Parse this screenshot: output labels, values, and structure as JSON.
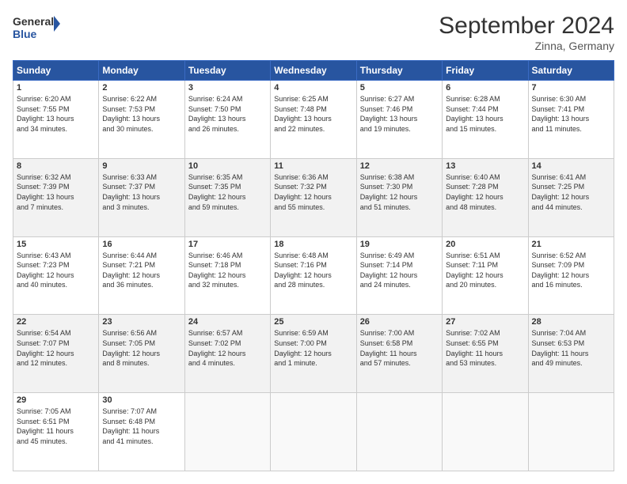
{
  "logo": {
    "line1": "General",
    "line2": "Blue"
  },
  "title": "September 2024",
  "location": "Zinna, Germany",
  "days_header": [
    "Sunday",
    "Monday",
    "Tuesday",
    "Wednesday",
    "Thursday",
    "Friday",
    "Saturday"
  ],
  "weeks": [
    [
      {
        "day": "1",
        "info": "Sunrise: 6:20 AM\nSunset: 7:55 PM\nDaylight: 13 hours\nand 34 minutes."
      },
      {
        "day": "2",
        "info": "Sunrise: 6:22 AM\nSunset: 7:53 PM\nDaylight: 13 hours\nand 30 minutes."
      },
      {
        "day": "3",
        "info": "Sunrise: 6:24 AM\nSunset: 7:50 PM\nDaylight: 13 hours\nand 26 minutes."
      },
      {
        "day": "4",
        "info": "Sunrise: 6:25 AM\nSunset: 7:48 PM\nDaylight: 13 hours\nand 22 minutes."
      },
      {
        "day": "5",
        "info": "Sunrise: 6:27 AM\nSunset: 7:46 PM\nDaylight: 13 hours\nand 19 minutes."
      },
      {
        "day": "6",
        "info": "Sunrise: 6:28 AM\nSunset: 7:44 PM\nDaylight: 13 hours\nand 15 minutes."
      },
      {
        "day": "7",
        "info": "Sunrise: 6:30 AM\nSunset: 7:41 PM\nDaylight: 13 hours\nand 11 minutes."
      }
    ],
    [
      {
        "day": "8",
        "info": "Sunrise: 6:32 AM\nSunset: 7:39 PM\nDaylight: 13 hours\nand 7 minutes."
      },
      {
        "day": "9",
        "info": "Sunrise: 6:33 AM\nSunset: 7:37 PM\nDaylight: 13 hours\nand 3 minutes."
      },
      {
        "day": "10",
        "info": "Sunrise: 6:35 AM\nSunset: 7:35 PM\nDaylight: 12 hours\nand 59 minutes."
      },
      {
        "day": "11",
        "info": "Sunrise: 6:36 AM\nSunset: 7:32 PM\nDaylight: 12 hours\nand 55 minutes."
      },
      {
        "day": "12",
        "info": "Sunrise: 6:38 AM\nSunset: 7:30 PM\nDaylight: 12 hours\nand 51 minutes."
      },
      {
        "day": "13",
        "info": "Sunrise: 6:40 AM\nSunset: 7:28 PM\nDaylight: 12 hours\nand 48 minutes."
      },
      {
        "day": "14",
        "info": "Sunrise: 6:41 AM\nSunset: 7:25 PM\nDaylight: 12 hours\nand 44 minutes."
      }
    ],
    [
      {
        "day": "15",
        "info": "Sunrise: 6:43 AM\nSunset: 7:23 PM\nDaylight: 12 hours\nand 40 minutes."
      },
      {
        "day": "16",
        "info": "Sunrise: 6:44 AM\nSunset: 7:21 PM\nDaylight: 12 hours\nand 36 minutes."
      },
      {
        "day": "17",
        "info": "Sunrise: 6:46 AM\nSunset: 7:18 PM\nDaylight: 12 hours\nand 32 minutes."
      },
      {
        "day": "18",
        "info": "Sunrise: 6:48 AM\nSunset: 7:16 PM\nDaylight: 12 hours\nand 28 minutes."
      },
      {
        "day": "19",
        "info": "Sunrise: 6:49 AM\nSunset: 7:14 PM\nDaylight: 12 hours\nand 24 minutes."
      },
      {
        "day": "20",
        "info": "Sunrise: 6:51 AM\nSunset: 7:11 PM\nDaylight: 12 hours\nand 20 minutes."
      },
      {
        "day": "21",
        "info": "Sunrise: 6:52 AM\nSunset: 7:09 PM\nDaylight: 12 hours\nand 16 minutes."
      }
    ],
    [
      {
        "day": "22",
        "info": "Sunrise: 6:54 AM\nSunset: 7:07 PM\nDaylight: 12 hours\nand 12 minutes."
      },
      {
        "day": "23",
        "info": "Sunrise: 6:56 AM\nSunset: 7:05 PM\nDaylight: 12 hours\nand 8 minutes."
      },
      {
        "day": "24",
        "info": "Sunrise: 6:57 AM\nSunset: 7:02 PM\nDaylight: 12 hours\nand 4 minutes."
      },
      {
        "day": "25",
        "info": "Sunrise: 6:59 AM\nSunset: 7:00 PM\nDaylight: 12 hours\nand 1 minute."
      },
      {
        "day": "26",
        "info": "Sunrise: 7:00 AM\nSunset: 6:58 PM\nDaylight: 11 hours\nand 57 minutes."
      },
      {
        "day": "27",
        "info": "Sunrise: 7:02 AM\nSunset: 6:55 PM\nDaylight: 11 hours\nand 53 minutes."
      },
      {
        "day": "28",
        "info": "Sunrise: 7:04 AM\nSunset: 6:53 PM\nDaylight: 11 hours\nand 49 minutes."
      }
    ],
    [
      {
        "day": "29",
        "info": "Sunrise: 7:05 AM\nSunset: 6:51 PM\nDaylight: 11 hours\nand 45 minutes."
      },
      {
        "day": "30",
        "info": "Sunrise: 7:07 AM\nSunset: 6:48 PM\nDaylight: 11 hours\nand 41 minutes."
      },
      {
        "day": "",
        "info": ""
      },
      {
        "day": "",
        "info": ""
      },
      {
        "day": "",
        "info": ""
      },
      {
        "day": "",
        "info": ""
      },
      {
        "day": "",
        "info": ""
      }
    ]
  ]
}
